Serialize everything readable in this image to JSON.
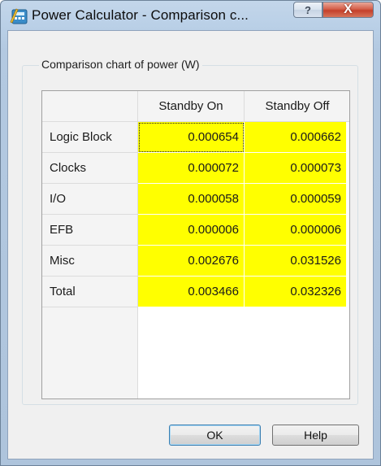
{
  "window": {
    "title": "Power Calculator - Comparison c...",
    "help_glyph": "?",
    "close_glyph": "X"
  },
  "group": {
    "legend": "Comparison chart of power (W)"
  },
  "table": {
    "columns": [
      "Standby On",
      "Standby Off"
    ],
    "rows": [
      {
        "label": "Logic Block",
        "values": [
          "0.000654",
          "0.000662"
        ]
      },
      {
        "label": "Clocks",
        "values": [
          "0.000072",
          "0.000073"
        ]
      },
      {
        "label": "I/O",
        "values": [
          "0.000058",
          "0.000059"
        ]
      },
      {
        "label": "EFB",
        "values": [
          "0.000006",
          "0.000006"
        ]
      },
      {
        "label": "Misc",
        "values": [
          "0.002676",
          "0.031526"
        ]
      },
      {
        "label": "Total",
        "values": [
          "0.003466",
          "0.032326"
        ]
      }
    ],
    "selected_cell": "0.000654"
  },
  "buttons": {
    "ok": "OK",
    "help": "Help"
  },
  "colors": {
    "value_highlight": "#ffff00",
    "close_button": "#c4402a"
  }
}
